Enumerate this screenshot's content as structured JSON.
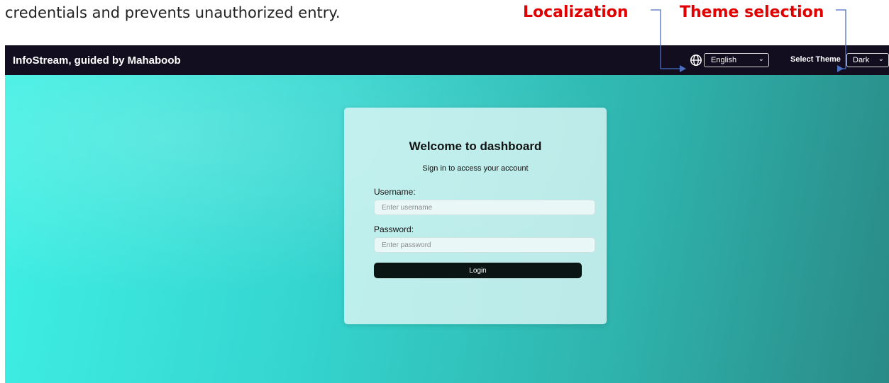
{
  "caption": "credentials and prevents unauthorized entry.",
  "annotations": {
    "localization": "Localization",
    "theme_selection": "Theme selection",
    "color": "#e00000"
  },
  "navbar": {
    "brand": "InfoStream, guided by Mahaboob",
    "globe_icon": "globe-icon",
    "language": {
      "selected": "English"
    },
    "theme_label": "Select Theme",
    "theme": {
      "selected": "Dark"
    },
    "background": "#120e1f"
  },
  "login": {
    "title": "Welcome to dashboard",
    "subtitle": "Sign in to access your account",
    "username_label": "Username:",
    "username_placeholder": "Enter username",
    "password_label": "Password:",
    "password_placeholder": "Enter password",
    "login_button": "Login"
  },
  "colors": {
    "hero_start": "#3ff0e4",
    "hero_end": "#2a8a86",
    "button": "#0b1514"
  }
}
